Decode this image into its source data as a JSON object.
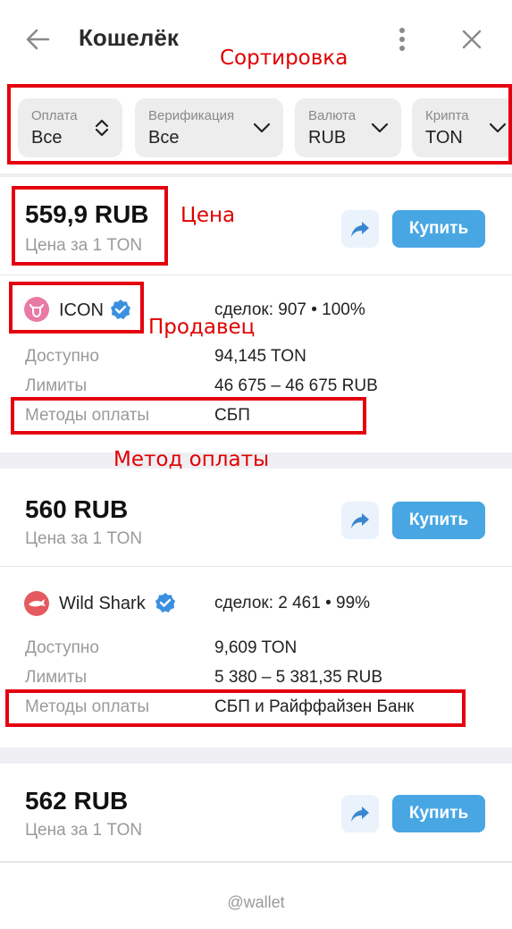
{
  "header": {
    "title": "Кошелёк",
    "back_icon": "arrow-left-icon",
    "menu_icon": "more-vertical-icon",
    "close_icon": "close-icon"
  },
  "annotations": {
    "sort": "Сортировка",
    "price": "Цена",
    "seller": "Продавец",
    "payment_method": "Метод оплаты",
    "color": "#e4000f"
  },
  "filters": [
    {
      "label": "Оплата",
      "value": "Все",
      "icon": "sort-updown-icon"
    },
    {
      "label": "Верификация",
      "value": "Все",
      "icon": "chevron-down-icon"
    },
    {
      "label": "Валюта",
      "value": "RUB",
      "icon": "chevron-down-icon"
    },
    {
      "label": "Крипта",
      "value": "TON",
      "icon": "chevron-down-icon"
    }
  ],
  "offers": [
    {
      "price": "559,9 RUB",
      "price_sub": "Цена за 1 TON",
      "buy_label": "Купить",
      "seller": "ICON",
      "avatar_color": "#e87aa5",
      "deals": "сделок: 907 • 100%",
      "rows": [
        {
          "label": "Доступно",
          "value": "94,145 TON"
        },
        {
          "label": "Лимиты",
          "value": "46 675 – 46 675 RUB"
        },
        {
          "label": "Методы оплаты",
          "value": "СБП"
        }
      ]
    },
    {
      "price": "560 RUB",
      "price_sub": "Цена за 1 TON",
      "buy_label": "Купить",
      "seller": "Wild Shark",
      "avatar_color": "#e45a5f",
      "deals": "сделок: 2 461 • 99%",
      "rows": [
        {
          "label": "Доступно",
          "value": "9,609 TON"
        },
        {
          "label": "Лимиты",
          "value": "5 380 – 5 381,35 RUB"
        },
        {
          "label": "Методы оплаты",
          "value": "СБП и Райффайзен Банк"
        }
      ]
    },
    {
      "price": "562 RUB",
      "price_sub": "Цена за 1 TON",
      "buy_label": "Купить"
    }
  ],
  "footer": {
    "text": "@wallet"
  },
  "colors": {
    "accent": "#48a7e3",
    "verified": "#3b8fe0",
    "background_gray": "#efeff3"
  }
}
